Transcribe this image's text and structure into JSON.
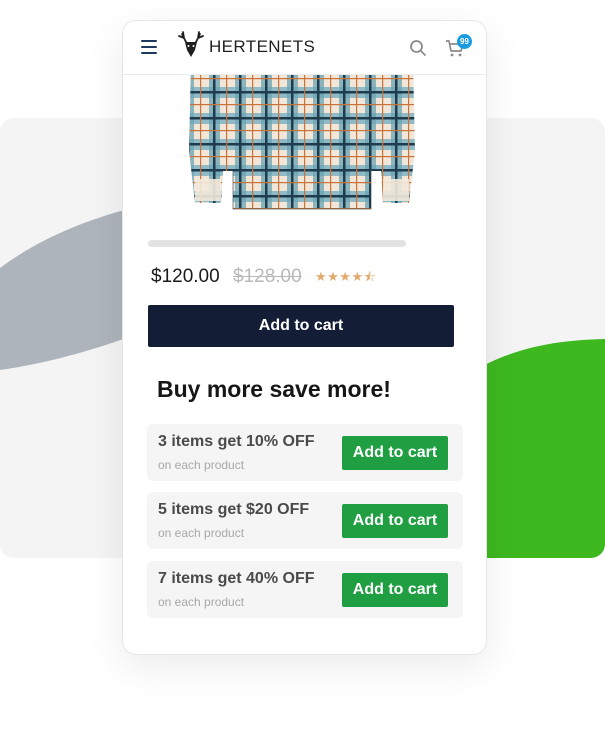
{
  "header": {
    "brand": "HERTENETS",
    "cart_count": "99"
  },
  "product": {
    "price": "$120.00",
    "old_price": "$128.00",
    "rating": 4.5,
    "stars_text": "★★★★⯪"
  },
  "actions": {
    "add_to_cart": "Add to cart"
  },
  "offers": {
    "title": "Buy more save more!",
    "items": [
      {
        "title": "3 items get 10% OFF",
        "subtitle": "on each product",
        "button": "Add to cart"
      },
      {
        "title": "5 items get $20 OFF",
        "subtitle": "on each product",
        "button": "Add to cart"
      },
      {
        "title": "7 items get 40% OFF",
        "subtitle": "on each product",
        "button": "Add to cart"
      }
    ]
  },
  "colors": {
    "primary_button": "#131d36",
    "offer_button": "#1f9f42",
    "badge": "#1a9be0",
    "star": "#e2a96a",
    "accent_green": "#3db81f",
    "accent_gray": "#aeb4bb"
  },
  "icons": [
    "menu-icon",
    "deer-logo-icon",
    "search-icon",
    "cart-icon"
  ]
}
